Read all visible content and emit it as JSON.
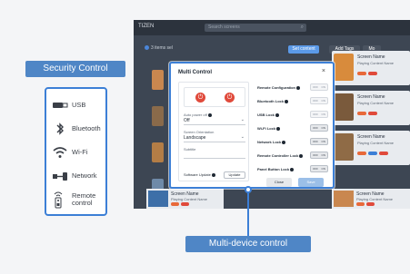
{
  "app": {
    "brand": "TIZEN",
    "search_placeholder": "Search screens",
    "filter_label": "3 items sel",
    "buttons": [
      "Set content",
      "Add Tags",
      "Mo"
    ],
    "right_cards": [
      {
        "title": "Screen Name",
        "subtitle": "Playing Content Name"
      },
      {
        "title": "Screen Name",
        "subtitle": "Playing Content Name"
      },
      {
        "title": "Screen Name",
        "subtitle": "Playing Content Name"
      }
    ],
    "bottom_cards": [
      {
        "title": "Screen Name",
        "subtitle": "Playing Content Name"
      },
      {
        "title": "Screen Name",
        "subtitle": "Playing Content Name"
      }
    ]
  },
  "dialog": {
    "title": "Multi Control",
    "close_glyph": "×",
    "left": {
      "field1_label": "Auto power off",
      "field1_value": "Off",
      "field2_label": "Screen Orientation",
      "field2_value": "Landscape",
      "field3_label": "Subtitle",
      "field3_value": "",
      "software_update_label": "Software Update",
      "software_update_button": "Update"
    },
    "locks": [
      {
        "label": "Remote Configuration",
        "off": "OFF",
        "on": "ON",
        "style": "light"
      },
      {
        "label": "Bluetooth Lock",
        "off": "OFF",
        "on": "ON",
        "style": "light"
      },
      {
        "label": "USB Lock",
        "off": "OFF",
        "on": "ON",
        "style": "light"
      },
      {
        "label": "Wi-Fi Lock",
        "off": "OFF",
        "on": "ON",
        "style": "dark"
      },
      {
        "label": "Network Lock",
        "off": "OFF",
        "on": "ON",
        "style": "dark"
      },
      {
        "label": "Remote Controller Lock",
        "off": "OFF",
        "on": "ON",
        "style": "dark"
      },
      {
        "label": "Panel Button Lock",
        "off": "OFF",
        "on": "ON",
        "style": "dark"
      }
    ],
    "close_button": "Close",
    "save_button": "Save"
  },
  "security": {
    "heading": "Security Control",
    "items": [
      {
        "label": "USB",
        "icon": "usb-icon"
      },
      {
        "label": "Bluetooth",
        "icon": "bluetooth-icon"
      },
      {
        "label": "Wi-Fi",
        "icon": "wifi-icon"
      },
      {
        "label": "Network",
        "icon": "network-icon"
      },
      {
        "label": "Remote\ncontrol",
        "icon": "remote-control-icon"
      }
    ]
  },
  "multi_device": {
    "label": "Multi-device control"
  },
  "colors": {
    "accent": "#3c7fd6",
    "label_bg": "#4f86c6",
    "power_red": "#e04a3b"
  }
}
